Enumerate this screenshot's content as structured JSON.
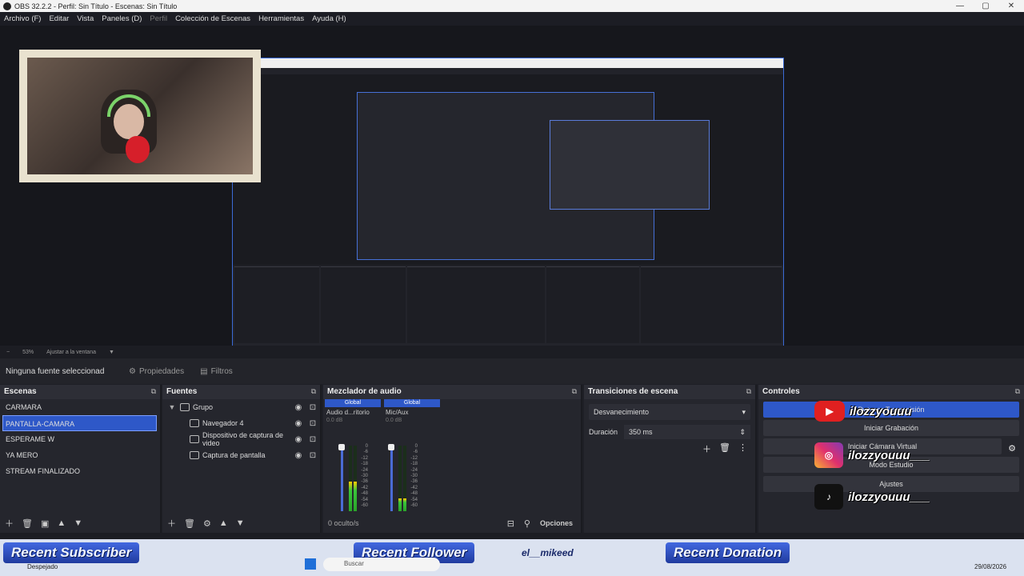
{
  "window": {
    "title": "OBS 32.2.2 - Perfil: Sin Título - Escenas: Sin Título",
    "minimize": "—",
    "maximize": "▢",
    "close": "✕"
  },
  "menu": [
    "Archivo (F)",
    "Editar",
    "Vista",
    "Paneles (D)",
    "Perfil",
    "Colección de Escenas",
    "Herramientas",
    "Ayuda (H)"
  ],
  "zoom": {
    "value": "53%",
    "fit": "Ajustar a la ventana"
  },
  "source_toolbar": {
    "no_selection": "Ninguna fuente seleccionad",
    "properties": "Propiedades",
    "filters": "Filtros"
  },
  "scenes": {
    "title": "Escenas",
    "items": [
      "CARMARA",
      "PANTALLA-CAMARA",
      "ESPERAME W",
      "YA MERO",
      "STREAM FINALIZADO"
    ],
    "active_index": 1
  },
  "sources": {
    "title": "Fuentes",
    "items": [
      {
        "name": "Grupo",
        "type": "folder"
      },
      {
        "name": "Navegador 4",
        "type": "browser"
      },
      {
        "name": "Dispositivo de captura de video",
        "type": "camera"
      },
      {
        "name": "Captura de pantalla",
        "type": "display"
      }
    ]
  },
  "mixer": {
    "title": "Mezclador de audio",
    "channels": [
      {
        "global": "Global",
        "name": "Audio d...ritorio",
        "db": "0.0 dB",
        "level": 0.45
      },
      {
        "global": "Global",
        "name": "Mic/Aux",
        "db": "0.0 dB",
        "level": 0.2
      }
    ],
    "ticks": [
      "0",
      "-6",
      "-12",
      "-18",
      "-24",
      "-30",
      "-36",
      "-42",
      "-48",
      "-54",
      "-60"
    ],
    "hidden": "0 oculto/s",
    "options": "Opciones"
  },
  "transitions": {
    "title": "Transiciones de escena",
    "selected": "Desvanecimiento",
    "duration_label": "Duración",
    "duration_value": "350 ms"
  },
  "controls": {
    "title": "Controles",
    "buttons": [
      "Detener Transmisión",
      "Iniciar Grabación",
      "Iniciar Cámara Virtual",
      "Modo Estudio",
      "Ajustes"
    ],
    "social_handle_1": "ilozzyouuu",
    "social_handle_2": "ilozzyouuu___",
    "social_handle_3": "ilozzyouuu___"
  },
  "overlay": {
    "recent_subscriber": "Recent Subscriber",
    "recent_follower": "Recent Follower",
    "recent_donation": "Recent Donation",
    "handle": "el__mikeed"
  },
  "taskbar": {
    "weather": "Despejado",
    "search": "Buscar",
    "date": "29/08/2026"
  },
  "colors": {
    "accent": "#2e58c8",
    "youtube": "#e02020",
    "panel": "#25262d"
  }
}
